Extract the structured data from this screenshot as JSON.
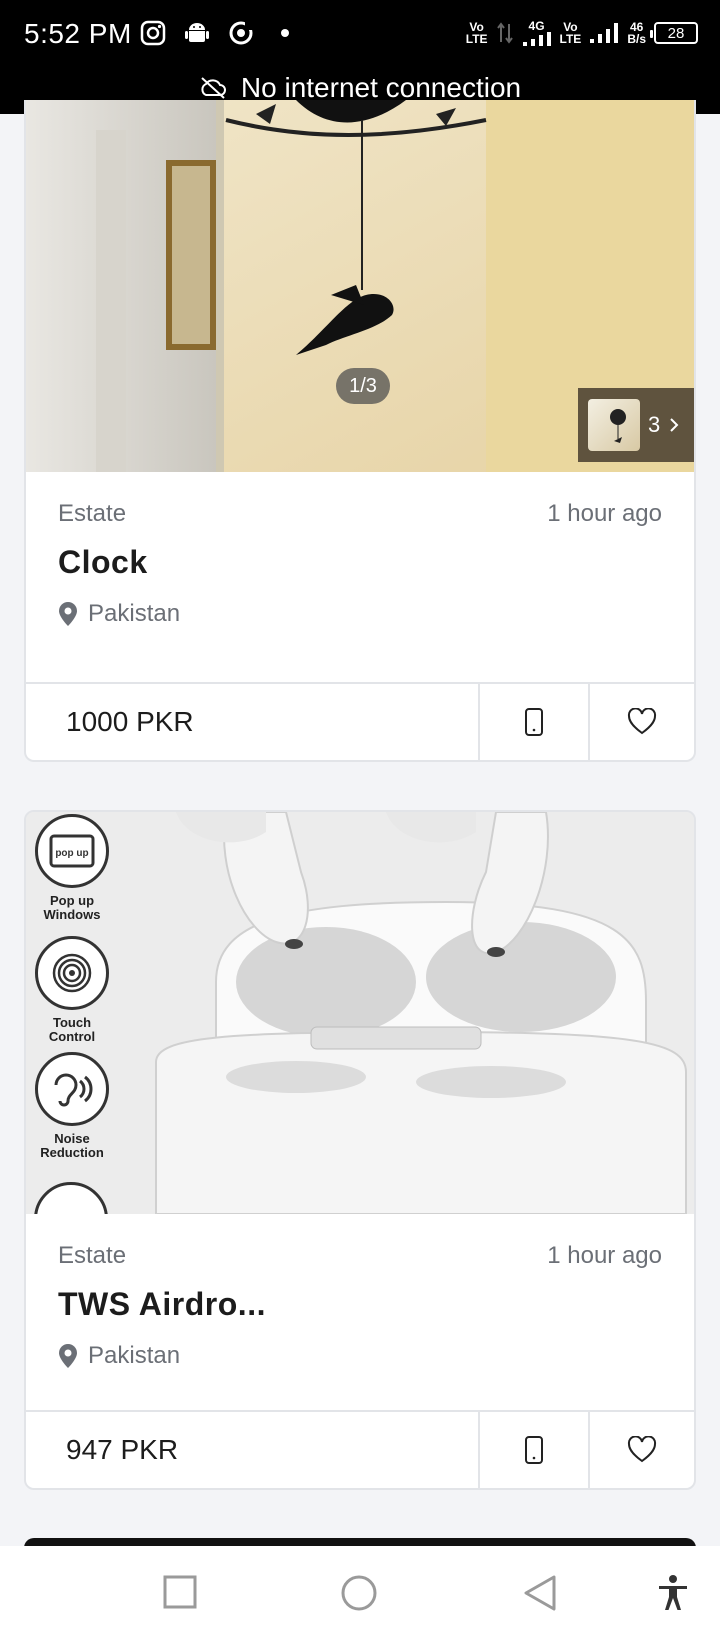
{
  "status_bar": {
    "time": "5:52 PM",
    "net_1_top": "Vo",
    "net_1_bottom": "LTE",
    "net_2_top": "4G",
    "net_3_top": "Vo",
    "net_3_bottom": "LTE",
    "speed_top": "46",
    "speed_bottom": "B/s",
    "battery": "28",
    "icons_left": [
      "instagram-icon",
      "android-icon",
      "sync-icon",
      "dot-icon"
    ]
  },
  "offline_banner": {
    "text": "No internet connection"
  },
  "listings": [
    {
      "category": "Estate",
      "time": "1 hour ago",
      "title": "Clock",
      "location": "Pakistan",
      "price": "1000 PKR",
      "image_counter": "1/3",
      "gallery_count": "3"
    },
    {
      "category": "Estate",
      "time": "1 hour ago",
      "title": "TWS Airdro...",
      "location": "Pakistan",
      "price": "947 PKR",
      "features": [
        "Pop up Windows",
        "Touch Control",
        "Noise Reduction"
      ],
      "feature_badge": "pop up"
    }
  ],
  "nav": [
    "recents-button",
    "home-button",
    "back-button",
    "accessibility-button"
  ]
}
